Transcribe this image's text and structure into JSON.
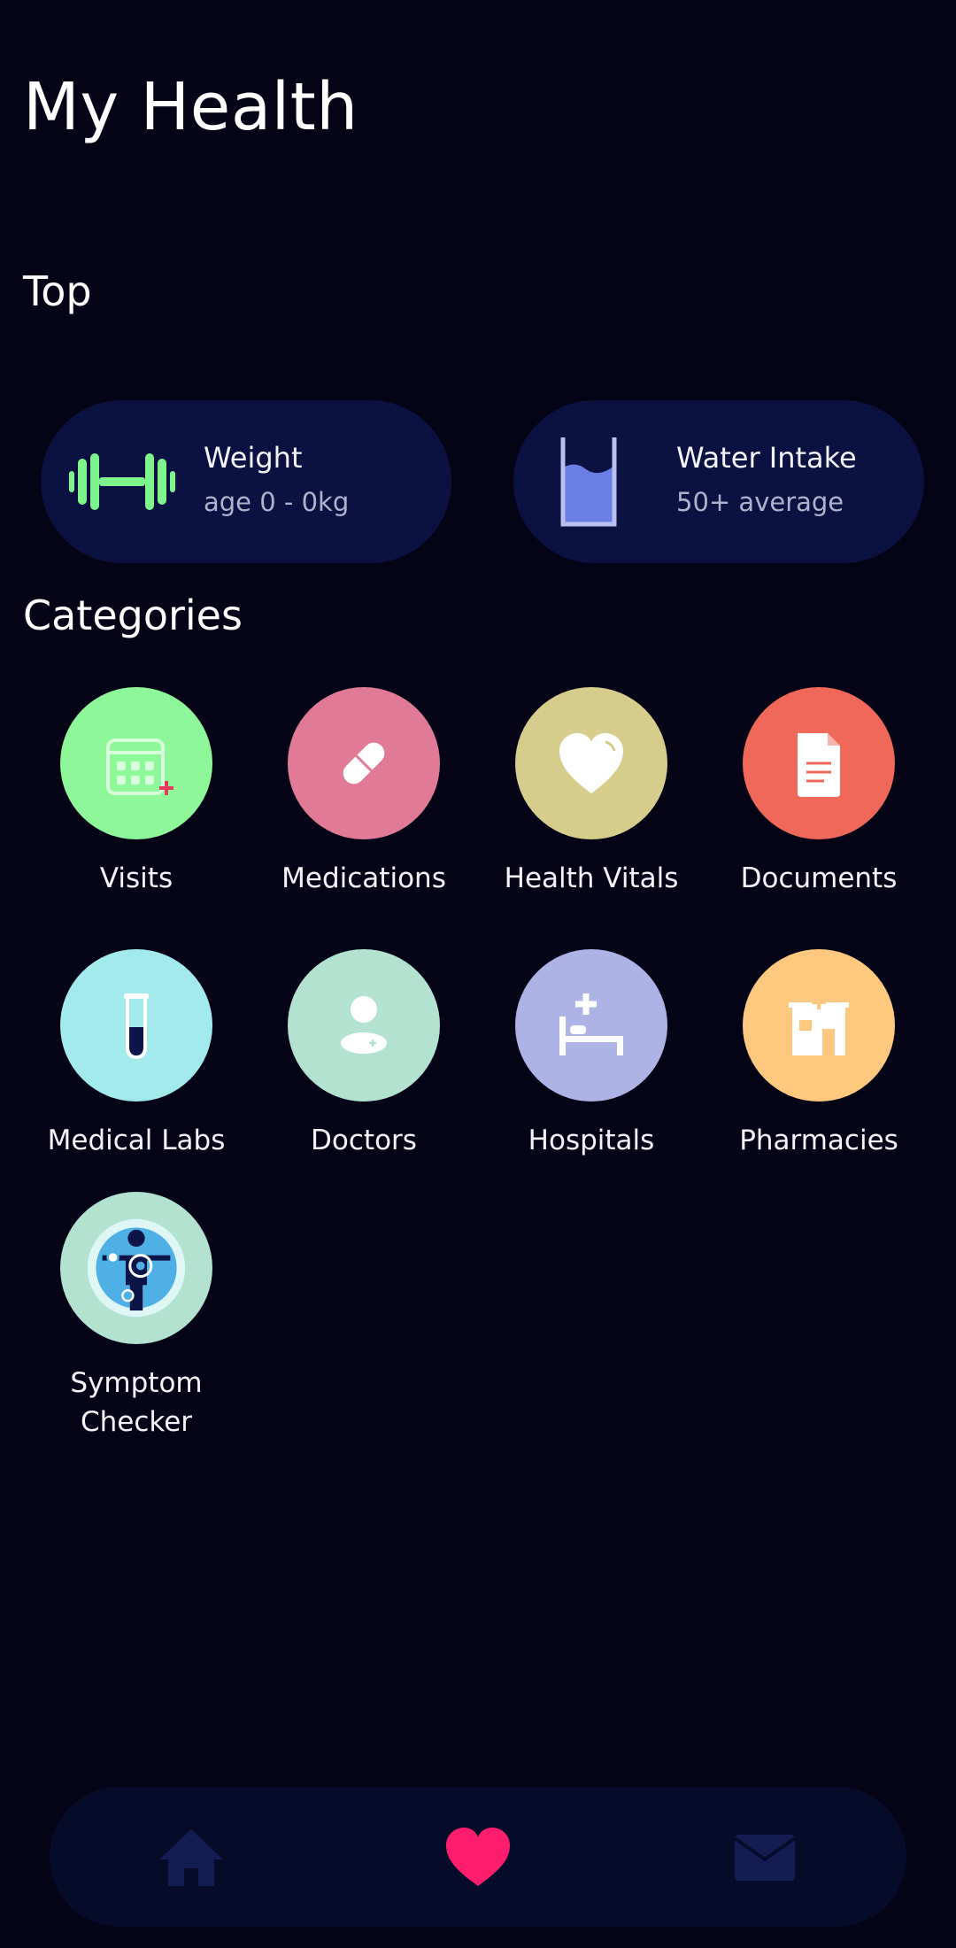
{
  "page": {
    "title": "My Health"
  },
  "sections": {
    "top": "Top",
    "categories": "Categories"
  },
  "top_cards": [
    {
      "label": "Weight",
      "sub": "age 0 - 0kg",
      "icon": "dumbbell-icon"
    },
    {
      "label": "Water Intake",
      "sub": "50+ average",
      "icon": "water-glass-icon"
    }
  ],
  "categories": [
    {
      "label": "Visits",
      "icon": "calendar-plus-icon",
      "color": "#8ef79a"
    },
    {
      "label": "Medications",
      "icon": "pill-icon",
      "color": "#e07a97"
    },
    {
      "label": "Health Vitals",
      "icon": "heart-icon",
      "color": "#d6cd8c"
    },
    {
      "label": "Documents",
      "icon": "document-icon",
      "color": "#f0685a"
    },
    {
      "label": "Medical Labs",
      "icon": "test-tube-icon",
      "color": "#a2eaeb"
    },
    {
      "label": "Doctors",
      "icon": "doctor-icon",
      "color": "#b3e2d1"
    },
    {
      "label": "Hospitals",
      "icon": "hospital-bed-icon",
      "color": "#aeb3e5"
    },
    {
      "label": "Pharmacies",
      "icon": "pharmacy-icon",
      "color": "#fec97f"
    },
    {
      "label": "Symptom Checker",
      "icon": "body-scan-icon",
      "color": "#b3e2d1"
    }
  ],
  "bottom_nav": [
    {
      "icon": "home-icon",
      "active": false
    },
    {
      "icon": "heart-icon",
      "active": true
    },
    {
      "icon": "mail-icon",
      "active": false
    }
  ],
  "colors": {
    "background": "#040416",
    "card": "#0b1241",
    "accent": "#ff1e6e",
    "nav_inactive": "#141d52"
  }
}
